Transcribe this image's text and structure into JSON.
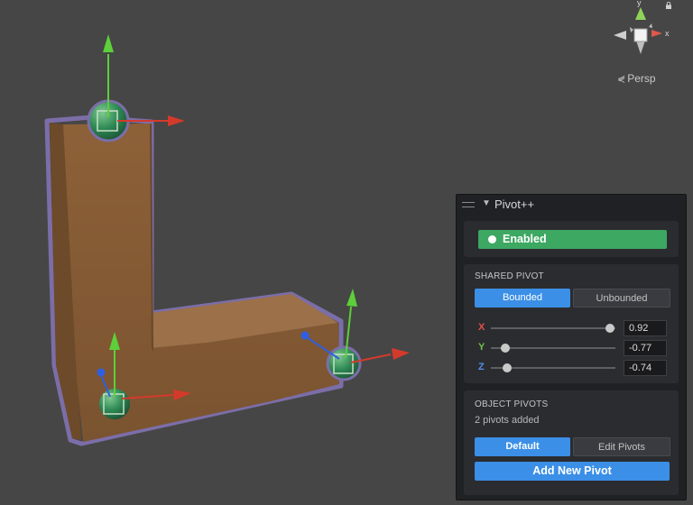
{
  "viewport": {
    "projection_label": "Persp",
    "gizmo_axes": {
      "x": "x",
      "y": "y"
    }
  },
  "panel": {
    "title": "Pivot++",
    "enabled_label": "Enabled",
    "shared_pivot": {
      "title": "SHARED PIVOT",
      "modes": [
        "Bounded",
        "Unbounded"
      ],
      "active_mode": "Bounded",
      "axes": [
        {
          "label": "X",
          "value": "0.92",
          "level": 0.96,
          "color": "#e2504a"
        },
        {
          "label": "Y",
          "value": "-0.77",
          "level": 0.115,
          "color": "#6cc24a"
        },
        {
          "label": "Z",
          "value": "-0.74",
          "level": 0.13,
          "color": "#4f8fe8"
        }
      ]
    },
    "object_pivots": {
      "title": "OBJECT PIVOTS",
      "count_text": "2 pivots added",
      "modes": [
        "Default",
        "Edit Pivots"
      ],
      "active_mode": "Default",
      "add_label": "Add New Pivot"
    }
  },
  "colors": {
    "accent_blue": "#3b8fe6",
    "enabled_green": "#3da862",
    "object_brown": "#8a6038",
    "outline": "#7b6ea8"
  }
}
